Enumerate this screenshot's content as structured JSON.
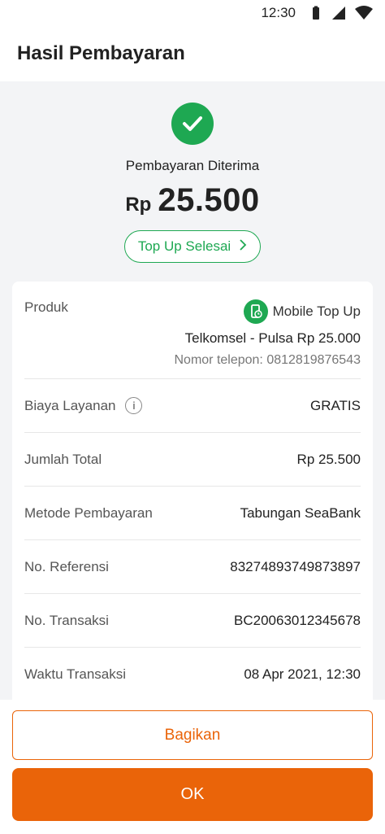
{
  "status_bar": {
    "time": "12:30",
    "icons": [
      "battery-icon",
      "signal-icon",
      "wifi-icon"
    ]
  },
  "header": {
    "title": "Hasil Pembayaran"
  },
  "result": {
    "icon": "check-icon",
    "status": "Pembayaran Diterima",
    "currency": "Rp",
    "amount": "25.500",
    "pill_label": "Top Up Selesai",
    "pill_icon": "chevron-right-icon"
  },
  "details": {
    "product": {
      "label": "Produk",
      "type": "Mobile Top Up",
      "type_icon": "mobile-topup-icon",
      "name": "Telkomsel - Pulsa Rp 25.000",
      "phone": "Nomor telepon: 0812819876543"
    },
    "service_fee": {
      "label": "Biaya Layanan",
      "icon": "info-icon",
      "value": "GRATIS"
    },
    "total": {
      "label": "Jumlah Total",
      "value": "Rp 25.500"
    },
    "payment_method": {
      "label": "Metode Pembayaran",
      "value": "Tabungan SeaBank"
    },
    "reference": {
      "label": "No. Referensi",
      "value": "83274893749873897"
    },
    "transaction": {
      "label": "No. Transaksi",
      "value": "BC20063012345678"
    },
    "time": {
      "label": "Waktu Transaksi",
      "value": "08 Apr 2021, 12:30"
    }
  },
  "actions": {
    "share_label": "Bagikan",
    "ok_label": "OK"
  },
  "colors": {
    "success": "#1ea852",
    "primary": "#ea6409",
    "background": "#f3f4f6"
  }
}
